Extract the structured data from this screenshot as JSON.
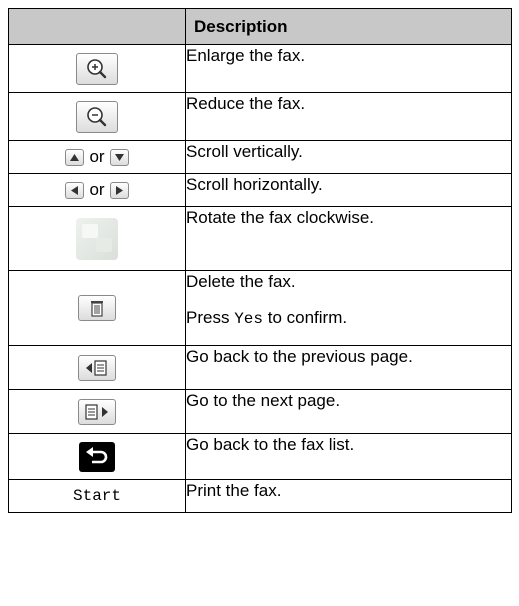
{
  "header": {
    "key_col": "",
    "desc_col": "Description"
  },
  "rows": [
    {
      "key": "zoom-in-button",
      "description": "Enlarge the fax."
    },
    {
      "key": "zoom-out-button",
      "description": "Reduce the fax."
    },
    {
      "key": "up-down-buttons",
      "or_label": "or",
      "description": "Scroll vertically."
    },
    {
      "key": "left-right-buttons",
      "or_label": "or",
      "description": "Scroll horizontally."
    },
    {
      "key": "rotate-button",
      "description": "Rotate the fax clockwise."
    },
    {
      "key": "trash-button",
      "description": "Delete the fax.",
      "desc2_prefix": "Press ",
      "desc2_code": "Yes",
      "desc2_suffix": " to confirm."
    },
    {
      "key": "prev-page-button",
      "description": "Go back to the previous page."
    },
    {
      "key": "next-page-button",
      "description": "Go to the next page."
    },
    {
      "key": "back-button",
      "description": "Go back to the fax list."
    },
    {
      "key": "start-key",
      "key_label": "Start",
      "description": "Print the fax."
    }
  ]
}
